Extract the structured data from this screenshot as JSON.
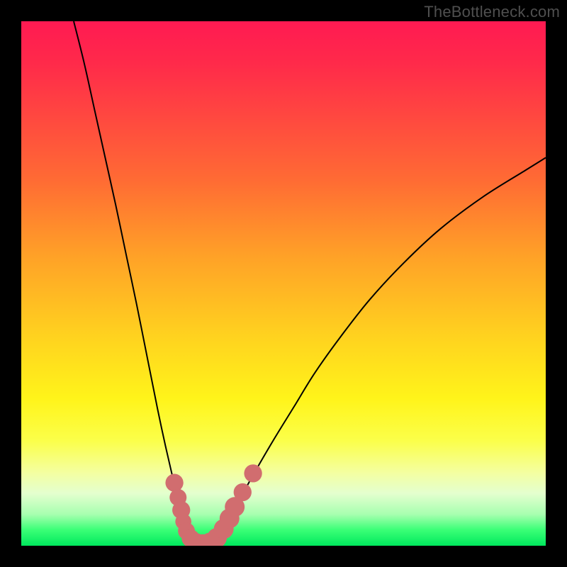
{
  "watermark": "TheBottleneck.com",
  "chart_data": {
    "type": "line",
    "title": "",
    "xlabel": "",
    "ylabel": "",
    "x_range": [
      0,
      100
    ],
    "y_range": [
      0,
      100
    ],
    "note": "Two monotone curves forming a V-shaped valley; y≈100 means high bottleneck (red), y≈0 means optimal (green). Values estimated from pixel positions.",
    "series": [
      {
        "name": "left-curve",
        "x": [
          10.0,
          12.0,
          14.0,
          16.0,
          18.0,
          20.0,
          22.0,
          24.0,
          26.0,
          27.5,
          29.0,
          30.2,
          31.2,
          32.0,
          32.8,
          33.4,
          34.0
        ],
        "y": [
          100.0,
          92.0,
          83.0,
          74.0,
          65.0,
          55.5,
          46.0,
          36.0,
          26.0,
          19.0,
          12.5,
          7.5,
          4.2,
          2.2,
          1.0,
          0.4,
          0.0
        ]
      },
      {
        "name": "right-curve",
        "x": [
          34.0,
          35.0,
          36.5,
          38.0,
          40.0,
          42.0,
          44.5,
          48.0,
          52.0,
          56.0,
          61.0,
          66.5,
          73.0,
          80.0,
          88.0,
          96.0,
          100.0
        ],
        "y": [
          0.0,
          0.3,
          1.2,
          3.0,
          6.0,
          9.5,
          14.0,
          20.0,
          26.5,
          33.0,
          40.0,
          47.0,
          54.0,
          60.5,
          66.5,
          71.5,
          74.0
        ]
      }
    ],
    "markers": {
      "name": "highlight-dots",
      "color": "#d16d6f",
      "points": [
        {
          "x": 29.2,
          "y": 12.0,
          "r": 1.3
        },
        {
          "x": 29.9,
          "y": 9.2,
          "r": 1.2
        },
        {
          "x": 30.5,
          "y": 6.8,
          "r": 1.3
        },
        {
          "x": 30.9,
          "y": 4.6,
          "r": 1.1
        },
        {
          "x": 31.5,
          "y": 2.8,
          "r": 1.2
        },
        {
          "x": 32.3,
          "y": 1.4,
          "r": 1.3
        },
        {
          "x": 33.3,
          "y": 0.6,
          "r": 1.4
        },
        {
          "x": 34.6,
          "y": 0.3,
          "r": 1.5
        },
        {
          "x": 36.0,
          "y": 0.6,
          "r": 1.5
        },
        {
          "x": 37.3,
          "y": 1.5,
          "r": 1.5
        },
        {
          "x": 38.6,
          "y": 3.2,
          "r": 1.5
        },
        {
          "x": 39.7,
          "y": 5.2,
          "r": 1.5
        },
        {
          "x": 40.7,
          "y": 7.4,
          "r": 1.5
        },
        {
          "x": 42.2,
          "y": 10.2,
          "r": 1.3
        },
        {
          "x": 44.2,
          "y": 13.8,
          "r": 1.3
        }
      ]
    }
  }
}
